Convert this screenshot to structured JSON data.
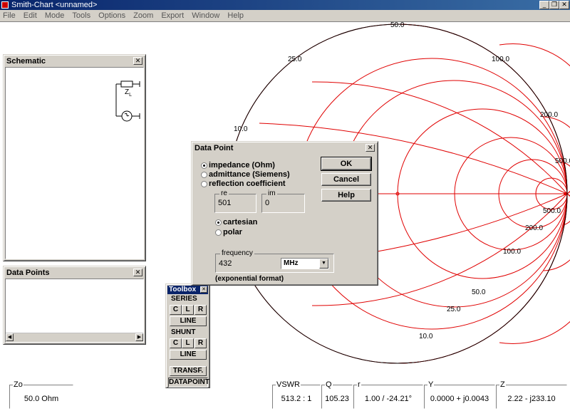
{
  "window": {
    "title": "Smith-Chart <unnamed>",
    "min": "_",
    "restore": "❐",
    "close": "✕"
  },
  "menu": [
    "File",
    "Edit",
    "Mode",
    "Tools",
    "Options",
    "Zoom",
    "Export",
    "Window",
    "Help"
  ],
  "schematic": {
    "title": "Schematic",
    "close": "✕",
    "load_label": "Z",
    "load_sub": "L"
  },
  "datapoints": {
    "title": "Data Points",
    "close": "✕"
  },
  "chart": {
    "labels": {
      "r25": "25.0",
      "r50": "50.0",
      "r100": "100.0",
      "r200": "200.0",
      "r500": "500.0",
      "r10": "10.0",
      "l25": "25.0",
      "l50": "50.0",
      "l100": "100.0",
      "l200": "200.0",
      "l500": "500.0",
      "l10": "10.0"
    },
    "color": "#e00000"
  },
  "dialog": {
    "title": "Data Point",
    "close": "✕",
    "opt_impedance": "impedance (Ohm)",
    "opt_admittance": "admittance (Siemens)",
    "opt_reflection": "reflection coefficient",
    "re_label": "re",
    "re_value": "501",
    "im_label": "im",
    "im_value": "0",
    "opt_cartesian": "cartesian",
    "opt_polar": "polar",
    "freq_label": "frequency",
    "freq_value": "432",
    "freq_unit": "MHz",
    "exp_note": "(exponential format)",
    "ok": "OK",
    "cancel": "Cancel",
    "help": "Help",
    "selected_mode": "impedance",
    "selected_coord": "cartesian"
  },
  "toolbox": {
    "title": "Toolbox",
    "close": "✕",
    "series": "SERIES",
    "shunt": "SHUNT",
    "c": "C",
    "l": "L",
    "r": "R",
    "line": "LINE",
    "transf": "TRANSF.",
    "datapoint": "DATAPOINT"
  },
  "status": {
    "zo_label": "Zo",
    "zo_value": "50.0 Ohm",
    "vswr_label": "VSWR",
    "vswr_value": "513.2 : 1",
    "q_label": "Q",
    "q_value": "105.23",
    "r_label": "r",
    "r_value": "1.00 / -24.21°",
    "y_label": "Y",
    "y_value": "0.0000 + j0.0043",
    "z_label": "Z",
    "z_value": "2.22 - j233.10"
  }
}
